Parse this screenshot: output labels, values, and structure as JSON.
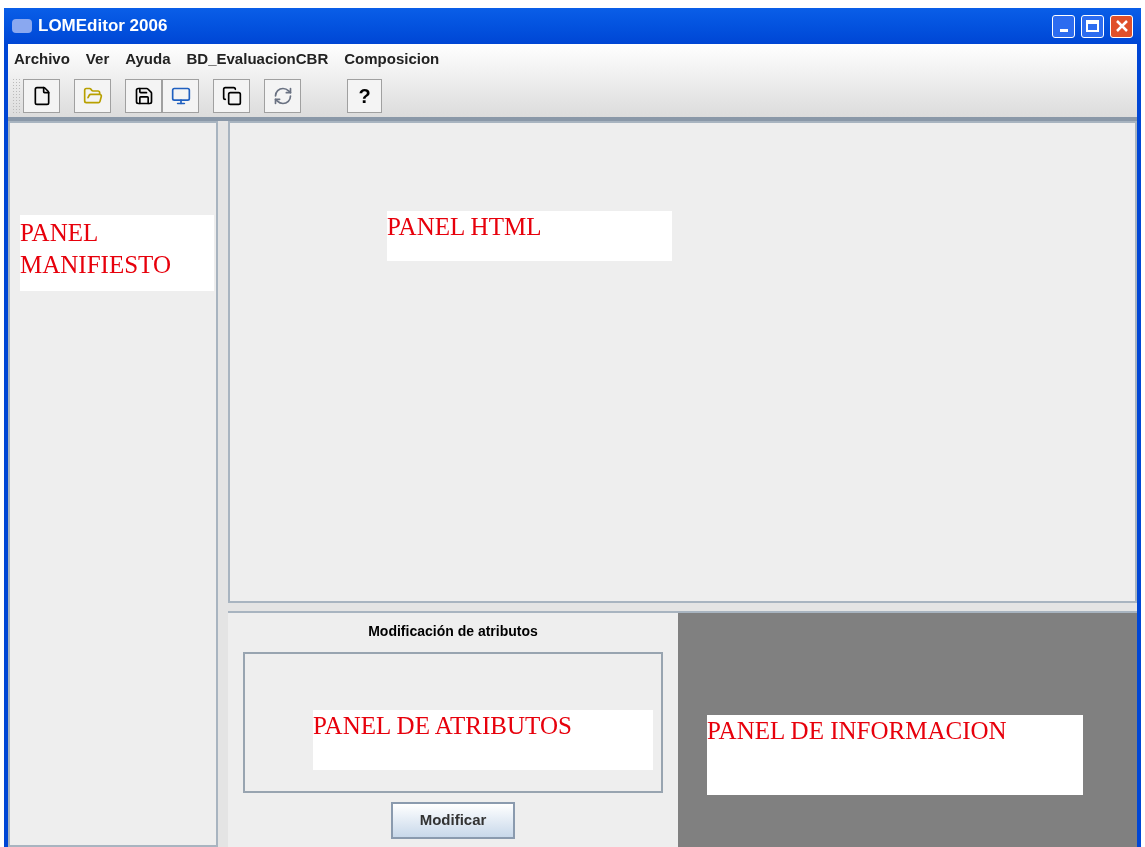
{
  "window": {
    "title": "LOMEditor 2006"
  },
  "menu": [
    "Archivo",
    "Ver",
    "Ayuda",
    "BD_EvaluacionCBR",
    "Composicion"
  ],
  "toolbar": [
    [
      {
        "kind": "new"
      }
    ],
    [
      {
        "kind": "open"
      }
    ],
    [
      {
        "kind": "save"
      },
      {
        "kind": "display"
      }
    ],
    [
      {
        "kind": "copy"
      }
    ],
    [
      {
        "kind": "refresh"
      }
    ],
    [
      {
        "kind": "text",
        "label": "?"
      }
    ]
  ],
  "manifest_panel": {
    "label_lines": [
      "PANEL",
      "MANIFIESTO"
    ]
  },
  "html_panel": {
    "label": "PANEL HTML"
  },
  "attributes_panel": {
    "title": "Modificación de atributos",
    "label": "PANEL DE ATRIBUTOS",
    "button": "Modificar"
  },
  "info_panel": {
    "label": "PANEL DE INFORMACION"
  }
}
